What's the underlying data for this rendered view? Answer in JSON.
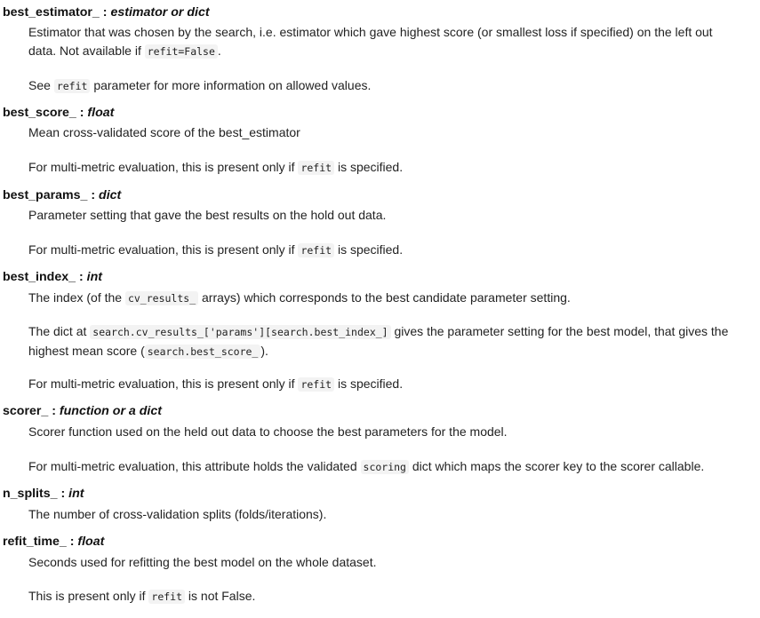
{
  "attributes": [
    {
      "name": "best_estimator_",
      "sep": " : ",
      "type": "estimator or dict",
      "p1": {
        "t1": "Estimator that was chosen by the search, i.e. estimator which gave highest score (or smallest loss if specified) on the left out data. Not available if ",
        "c1": "refit=False",
        "t2": "."
      },
      "p2": {
        "t1": "See ",
        "c1": "refit",
        "t2": " parameter for more information on allowed values."
      }
    },
    {
      "name": "best_score_",
      "sep": " : ",
      "type": "float",
      "p1": {
        "t1": "Mean cross-validated score of the best_estimator"
      },
      "p2": {
        "t1": "For multi-metric evaluation, this is present only if ",
        "c1": "refit",
        "t2": " is specified."
      }
    },
    {
      "name": "best_params_",
      "sep": " : ",
      "type": "dict",
      "p1": {
        "t1": "Parameter setting that gave the best results on the hold out data."
      },
      "p2": {
        "t1": "For multi-metric evaluation, this is present only if ",
        "c1": "refit",
        "t2": " is specified."
      }
    },
    {
      "name": "best_index_",
      "sep": " : ",
      "type": "int",
      "p1": {
        "t1": "The index (of the ",
        "c1": "cv_results_",
        "t2": " arrays) which corresponds to the best candidate parameter setting."
      },
      "p2": {
        "t1": "The dict at ",
        "c1": "search.cv_results_['params'][search.best_index_]",
        "t2": " gives the parameter setting for the best model, that gives the highest mean score (",
        "c2": "search.best_score_",
        "t3": ")."
      },
      "p3": {
        "t1": "For multi-metric evaluation, this is present only if ",
        "c1": "refit",
        "t2": " is specified."
      }
    },
    {
      "name": "scorer_",
      "sep": " : ",
      "type": "function or a dict",
      "p1": {
        "t1": "Scorer function used on the held out data to choose the best parameters for the model."
      },
      "p2": {
        "t1": "For multi-metric evaluation, this attribute holds the validated ",
        "c1": "scoring",
        "t2": " dict which maps the scorer key to the scorer callable."
      }
    },
    {
      "name": "n_splits_",
      "sep": " : ",
      "type": "int",
      "p1": {
        "t1": "The number of cross-validation splits (folds/iterations)."
      }
    },
    {
      "name": "refit_time_",
      "sep": " : ",
      "type": "float",
      "p1": {
        "t1": "Seconds used for refitting the best model on the whole dataset."
      },
      "p2": {
        "t1": "This is present only if ",
        "c1": "refit",
        "t2": " is not False."
      }
    }
  ]
}
